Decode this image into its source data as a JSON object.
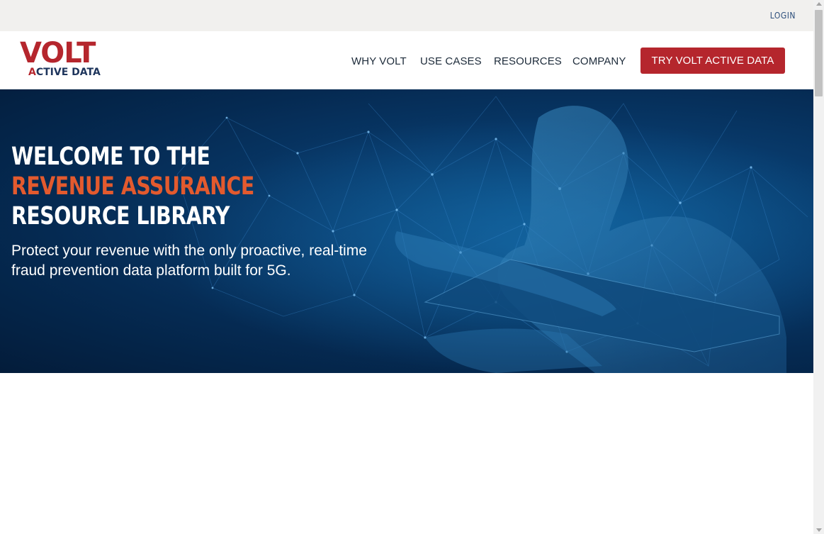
{
  "topbar": {
    "login_label": "LOGIN"
  },
  "brand": {
    "logo_text": "VOLT",
    "logo_subtext_a": "A",
    "logo_subtext_b": "CTIVE DATA"
  },
  "nav": {
    "items": [
      {
        "label": "WHY VOLT"
      },
      {
        "label": "USE CASES"
      },
      {
        "label": "RESOURCES"
      },
      {
        "label": "COMPANY"
      }
    ],
    "cta_label": "TRY VOLT ACTIVE DATA"
  },
  "hero": {
    "title_line1": "WELCOME TO THE",
    "title_line2": "REVENUE ASSURANCE",
    "title_line3": "RESOURCE LIBRARY",
    "subtitle": "Protect your revenue with the only proactive, real-time fraud prevention data platform built for 5G."
  },
  "colors": {
    "brand_red": "#b5262d",
    "navy": "#1e355c",
    "hero_orange": "#e35a2e",
    "hero_bg": "#052a52"
  }
}
